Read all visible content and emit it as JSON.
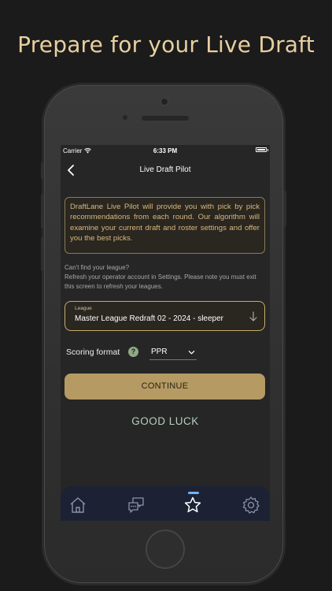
{
  "marketing": {
    "headline": "Prepare for your Live Draft"
  },
  "status_bar": {
    "carrier": "Carrier",
    "time": "6:33 PM"
  },
  "nav": {
    "title": "Live Draft Pilot"
  },
  "content": {
    "info_text": "DraftLane Live Pilot will provide you with pick by pick recommendations from each round. Our algorithm will examine your current draft and roster settings and offer you the best picks.",
    "note_line1": "Can't find your league?",
    "note_line2": "Refresh your operator account in Settings. Please note you must exit this screen to refresh your leagues.",
    "league": {
      "label": "League",
      "value": "Master League Redraft 02 - 2024 - sleeper"
    },
    "scoring": {
      "label": "Scoring format",
      "help": "?",
      "value": "PPR"
    },
    "continue_label": "CONTINUE",
    "good_luck": "GOOD LUCK"
  },
  "tabbar": {
    "items": [
      "home",
      "chat",
      "star",
      "settings"
    ],
    "active": "star"
  },
  "colors": {
    "gold": "#b59a63",
    "tab_bg": "#1c2234",
    "accent_blue": "#6fb1ff"
  }
}
